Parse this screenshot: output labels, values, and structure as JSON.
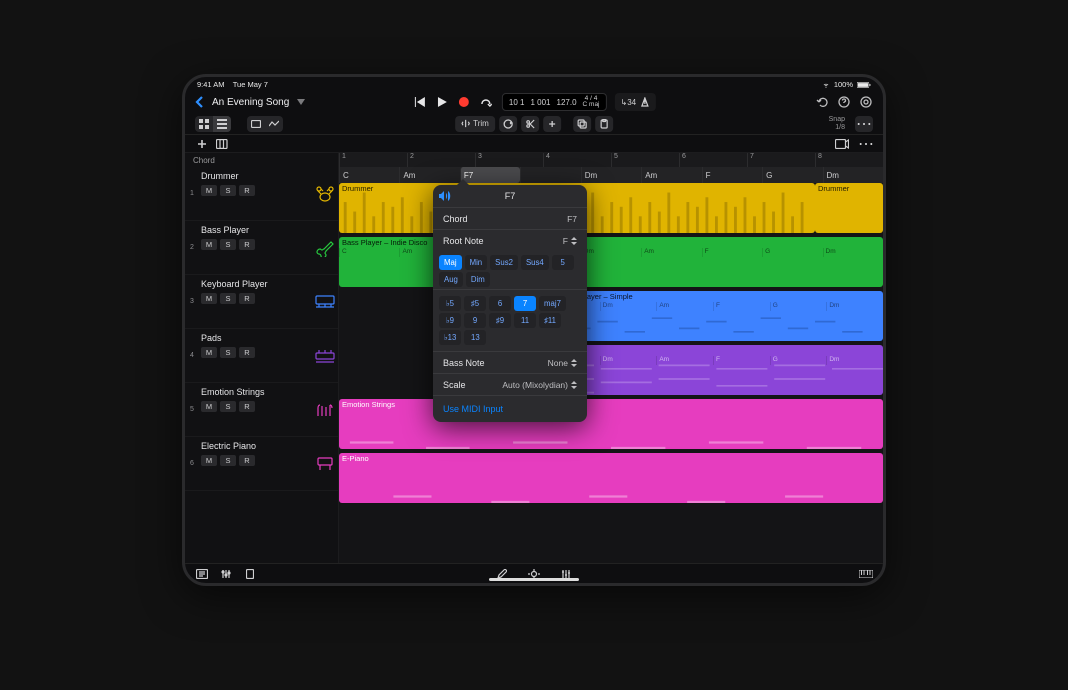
{
  "statusbar": {
    "time": "9:41 AM",
    "date": "Tue May 7",
    "battery_pct": "100%"
  },
  "titlebar": {
    "title": "An Evening Song",
    "lcd": {
      "bars": "10 1",
      "beats": "1 001",
      "tempo": "127.0",
      "sig_top": "4 / 4",
      "sig_bottom": "C maj"
    },
    "tempo_chip": "↳34"
  },
  "toolbar2": {
    "trim_label": "Trim",
    "snap_label": "Snap",
    "snap_value": "1/8"
  },
  "tracklist": {
    "chord_label": "Chord",
    "items": [
      {
        "index": "1",
        "name": "Drummer",
        "color": "#e6b800"
      },
      {
        "index": "2",
        "name": "Bass Player",
        "color": "#27c93f"
      },
      {
        "index": "3",
        "name": "Keyboard Player",
        "color": "#3e82ff"
      },
      {
        "index": "4",
        "name": "Pads",
        "color": "#8b45d8"
      },
      {
        "index": "5",
        "name": "Emotion Strings",
        "color": "#e63dbf"
      },
      {
        "index": "6",
        "name": "Electric Piano",
        "color": "#e63dbf"
      }
    ],
    "msr": {
      "m": "M",
      "s": "S",
      "r": "R"
    }
  },
  "ruler": {
    "ticks": [
      "1",
      "2",
      "3",
      "4",
      "5",
      "6",
      "7",
      "8"
    ]
  },
  "chord_row": {
    "labels": [
      "C",
      "Am",
      "F7",
      "",
      "Dm",
      "Am",
      "F",
      "G",
      "Dm"
    ],
    "selected_index": 2
  },
  "regions": {
    "labels": {
      "drummer": "Drummer",
      "drummer2": "Drummer",
      "bass": "Bass Player – Indie Disco",
      "keys": "Keyboard Player – Simple",
      "emotion": "Emotion Strings",
      "epiano": "E-Piano"
    },
    "overlay_chords": [
      "C",
      "Am",
      "F7",
      "",
      "Dm",
      "Am",
      "F",
      "G",
      "Dm"
    ]
  },
  "popover": {
    "title": "F7",
    "chord_label": "Chord",
    "chord_value": "F7",
    "root_label": "Root Note",
    "root_value": "F",
    "quality_row": [
      "Maj",
      "Min",
      "Sus2",
      "Sus4",
      "5"
    ],
    "quality_row2": [
      "Aug",
      "Dim"
    ],
    "ext_row1": [
      "♭5",
      "♯5",
      "6",
      "7",
      "maj7"
    ],
    "ext_row2": [
      "♭9",
      "9",
      "♯9",
      "11",
      "♯11"
    ],
    "ext_row3": [
      "♭13",
      "13"
    ],
    "selected_quality": "Maj",
    "selected_ext": "7",
    "bass_label": "Bass Note",
    "bass_value": "None",
    "scale_label": "Scale",
    "scale_value": "Auto (Mixolydian)",
    "midi_link": "Use MIDI Input"
  }
}
